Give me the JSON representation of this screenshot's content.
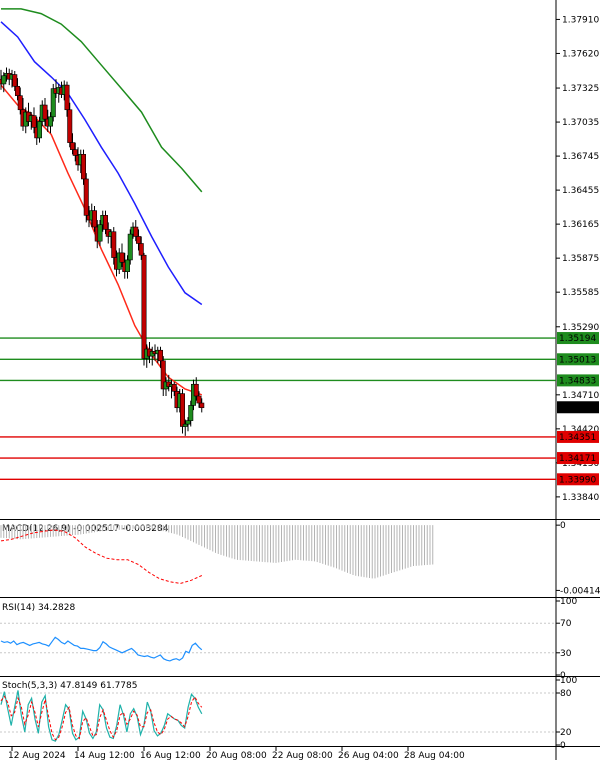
{
  "chart_data": [
    {
      "type": "candlestick",
      "price_scale": {
        "ticks": [
          "1.37910",
          "1.37620",
          "1.37325",
          "1.37035",
          "1.36745",
          "1.36455",
          "1.36165",
          "1.35875",
          "1.35585",
          "1.35290",
          "1.34710",
          "1.34420",
          "1.34130",
          "1.33840"
        ],
        "tick_values": [
          1.3791,
          1.3762,
          1.37325,
          1.37035,
          1.36745,
          1.36455,
          1.36165,
          1.35875,
          1.35585,
          1.3529,
          1.3471,
          1.3442,
          1.3413,
          1.3384
        ],
        "ylim": [
          1.3366,
          1.3805
        ]
      },
      "time_scale": {
        "labels": [
          "12 Aug 2024",
          "14 Aug 12:00",
          "16 Aug 12:00",
          "20 Aug 08:00",
          "22 Aug 08:00",
          "26 Aug 04:00",
          "28 Aug 04:00"
        ],
        "label_bars": [
          4,
          28,
          52,
          76,
          100,
          124,
          148
        ]
      },
      "bar_count": 158,
      "candles": [
        {
          "o": 1.374,
          "h": 1.3748,
          "l": 1.3731,
          "c": 1.3736
        },
        {
          "o": 1.3736,
          "h": 1.3746,
          "l": 1.3729,
          "c": 1.3743
        },
        {
          "o": 1.3743,
          "h": 1.375,
          "l": 1.3738,
          "c": 1.3745
        },
        {
          "o": 1.3745,
          "h": 1.3749,
          "l": 1.3735,
          "c": 1.374
        },
        {
          "o": 1.374,
          "h": 1.3748,
          "l": 1.3733,
          "c": 1.3744
        },
        {
          "o": 1.3744,
          "h": 1.3747,
          "l": 1.373,
          "c": 1.3734
        },
        {
          "o": 1.3734,
          "h": 1.3741,
          "l": 1.3722,
          "c": 1.3726
        },
        {
          "o": 1.3726,
          "h": 1.3733,
          "l": 1.371,
          "c": 1.3714
        },
        {
          "o": 1.3714,
          "h": 1.3724,
          "l": 1.3696,
          "c": 1.37
        },
        {
          "o": 1.37,
          "h": 1.3716,
          "l": 1.3694,
          "c": 1.3712
        },
        {
          "o": 1.3712,
          "h": 1.372,
          "l": 1.37,
          "c": 1.3704
        },
        {
          "o": 1.3704,
          "h": 1.3712,
          "l": 1.3697,
          "c": 1.3709
        },
        {
          "o": 1.3709,
          "h": 1.3716,
          "l": 1.3694,
          "c": 1.3699
        },
        {
          "o": 1.3699,
          "h": 1.3708,
          "l": 1.3684,
          "c": 1.369
        },
        {
          "o": 1.369,
          "h": 1.3708,
          "l": 1.3686,
          "c": 1.3704
        },
        {
          "o": 1.3704,
          "h": 1.3722,
          "l": 1.37,
          "c": 1.3718
        },
        {
          "o": 1.3718,
          "h": 1.3724,
          "l": 1.37,
          "c": 1.3706
        },
        {
          "o": 1.3706,
          "h": 1.3714,
          "l": 1.3695,
          "c": 1.37
        },
        {
          "o": 1.37,
          "h": 1.3712,
          "l": 1.3694,
          "c": 1.3708
        },
        {
          "o": 1.3708,
          "h": 1.3736,
          "l": 1.3704,
          "c": 1.3732
        },
        {
          "o": 1.3732,
          "h": 1.374,
          "l": 1.3724,
          "c": 1.3728
        },
        {
          "o": 1.3728,
          "h": 1.3736,
          "l": 1.372,
          "c": 1.3733
        },
        {
          "o": 1.3733,
          "h": 1.3738,
          "l": 1.3724,
          "c": 1.3727
        },
        {
          "o": 1.3727,
          "h": 1.3739,
          "l": 1.3722,
          "c": 1.3735
        },
        {
          "o": 1.3735,
          "h": 1.3738,
          "l": 1.3708,
          "c": 1.3714
        },
        {
          "o": 1.3714,
          "h": 1.372,
          "l": 1.3682,
          "c": 1.3686
        },
        {
          "o": 1.3686,
          "h": 1.3694,
          "l": 1.3676,
          "c": 1.368
        },
        {
          "o": 1.368,
          "h": 1.3686,
          "l": 1.367,
          "c": 1.3675
        },
        {
          "o": 1.3675,
          "h": 1.3682,
          "l": 1.3662,
          "c": 1.3667
        },
        {
          "o": 1.3667,
          "h": 1.368,
          "l": 1.366,
          "c": 1.3676
        },
        {
          "o": 1.3676,
          "h": 1.368,
          "l": 1.365,
          "c": 1.3655
        },
        {
          "o": 1.3655,
          "h": 1.366,
          "l": 1.3618,
          "c": 1.3624
        },
        {
          "o": 1.3624,
          "h": 1.3632,
          "l": 1.3614,
          "c": 1.362
        },
        {
          "o": 1.362,
          "h": 1.3634,
          "l": 1.3614,
          "c": 1.3628
        },
        {
          "o": 1.3628,
          "h": 1.3632,
          "l": 1.361,
          "c": 1.3614
        },
        {
          "o": 1.3614,
          "h": 1.362,
          "l": 1.3596,
          "c": 1.3602
        },
        {
          "o": 1.3602,
          "h": 1.362,
          "l": 1.3598,
          "c": 1.3616
        },
        {
          "o": 1.3616,
          "h": 1.3628,
          "l": 1.361,
          "c": 1.3624
        },
        {
          "o": 1.3624,
          "h": 1.3628,
          "l": 1.3608,
          "c": 1.3612
        },
        {
          "o": 1.3612,
          "h": 1.3618,
          "l": 1.36,
          "c": 1.3606
        },
        {
          "o": 1.3606,
          "h": 1.3612,
          "l": 1.3596,
          "c": 1.361
        },
        {
          "o": 1.361,
          "h": 1.3614,
          "l": 1.3582,
          "c": 1.3588
        },
        {
          "o": 1.3588,
          "h": 1.3594,
          "l": 1.3572,
          "c": 1.3578
        },
        {
          "o": 1.3578,
          "h": 1.3596,
          "l": 1.3574,
          "c": 1.3592
        },
        {
          "o": 1.3592,
          "h": 1.36,
          "l": 1.358,
          "c": 1.3584
        },
        {
          "o": 1.3584,
          "h": 1.3592,
          "l": 1.357,
          "c": 1.3576
        },
        {
          "o": 1.3576,
          "h": 1.359,
          "l": 1.357,
          "c": 1.3586
        },
        {
          "o": 1.3586,
          "h": 1.3612,
          "l": 1.3582,
          "c": 1.3608
        },
        {
          "o": 1.3608,
          "h": 1.3618,
          "l": 1.3604,
          "c": 1.3614
        },
        {
          "o": 1.3614,
          "h": 1.362,
          "l": 1.3602,
          "c": 1.3606
        },
        {
          "o": 1.3606,
          "h": 1.3612,
          "l": 1.3594,
          "c": 1.36
        },
        {
          "o": 1.36,
          "h": 1.3606,
          "l": 1.3586,
          "c": 1.359
        },
        {
          "o": 1.359,
          "h": 1.3592,
          "l": 1.3496,
          "c": 1.3502
        },
        {
          "o": 1.3502,
          "h": 1.3514,
          "l": 1.3494,
          "c": 1.351
        },
        {
          "o": 1.351,
          "h": 1.3516,
          "l": 1.3498,
          "c": 1.3504
        },
        {
          "o": 1.3504,
          "h": 1.3512,
          "l": 1.3496,
          "c": 1.3508
        },
        {
          "o": 1.3508,
          "h": 1.3514,
          "l": 1.35,
          "c": 1.3506
        },
        {
          "o": 1.3506,
          "h": 1.3512,
          "l": 1.3498,
          "c": 1.3509
        },
        {
          "o": 1.3509,
          "h": 1.3512,
          "l": 1.3494,
          "c": 1.35
        },
        {
          "o": 1.35,
          "h": 1.3504,
          "l": 1.347,
          "c": 1.3476
        },
        {
          "o": 1.3476,
          "h": 1.3486,
          "l": 1.347,
          "c": 1.3482
        },
        {
          "o": 1.3482,
          "h": 1.3488,
          "l": 1.3474,
          "c": 1.3478
        },
        {
          "o": 1.3478,
          "h": 1.3484,
          "l": 1.3468,
          "c": 1.348
        },
        {
          "o": 1.348,
          "h": 1.3482,
          "l": 1.347,
          "c": 1.3474
        },
        {
          "o": 1.3474,
          "h": 1.3478,
          "l": 1.3456,
          "c": 1.346
        },
        {
          "o": 1.346,
          "h": 1.3476,
          "l": 1.3456,
          "c": 1.3472
        },
        {
          "o": 1.3472,
          "h": 1.3476,
          "l": 1.3438,
          "c": 1.3444
        },
        {
          "o": 1.3444,
          "h": 1.345,
          "l": 1.3436,
          "c": 1.3446
        },
        {
          "o": 1.3446,
          "h": 1.3452,
          "l": 1.344,
          "c": 1.3449
        },
        {
          "o": 1.3449,
          "h": 1.3466,
          "l": 1.3444,
          "c": 1.3462
        },
        {
          "o": 1.3462,
          "h": 1.3484,
          "l": 1.3458,
          "c": 1.348
        },
        {
          "o": 1.348,
          "h": 1.3486,
          "l": 1.3466,
          "c": 1.347
        },
        {
          "o": 1.347,
          "h": 1.3474,
          "l": 1.346,
          "c": 1.3464
        },
        {
          "o": 1.3464,
          "h": 1.3468,
          "l": 1.3456,
          "c": 1.346
        }
      ],
      "moving_averages": [
        {
          "color": "#ff2a1a",
          "values": [
            1.3735,
            1.3718,
            1.3708,
            1.3693,
            1.366,
            1.363,
            1.3595,
            1.3565,
            1.353,
            1.3505,
            1.3486,
            1.3476,
            1.3471
          ]
        },
        {
          "color": "#1f1fff",
          "values": [
            1.3789,
            1.3776,
            1.3755,
            1.3742,
            1.3728,
            1.3706,
            1.3682,
            1.366,
            1.3634,
            1.3606,
            1.358,
            1.3558,
            1.3548
          ]
        },
        {
          "color": "#1e8c1e",
          "values": [
            1.38,
            1.38,
            1.3796,
            1.3787,
            1.3772,
            1.3752,
            1.3732,
            1.3712,
            1.3682,
            1.3664,
            1.3644
          ]
        }
      ],
      "levels": [
        {
          "value": 1.35194,
          "label": "1.35194",
          "color": "#1e8c1e"
        },
        {
          "value": 1.35013,
          "label": "1.35013",
          "color": "#1e8c1e"
        },
        {
          "value": 1.34833,
          "label": "1.34833",
          "color": "#1e8c1e"
        },
        {
          "value": 1.34351,
          "label": "1.34351",
          "color": "#e00000"
        },
        {
          "value": 1.34171,
          "label": "1.34171",
          "color": "#e00000"
        },
        {
          "value": 1.3399,
          "label": "1.33990",
          "color": "#e00000"
        }
      ],
      "current_price": {
        "value": 1.34604,
        "label": "1.34604"
      }
    },
    {
      "type": "histogram",
      "title": "MACD(12,26,9) -0.002517 -0.003284",
      "ticks": [
        "0",
        "-0.004145"
      ],
      "tick_values": [
        0,
        -0.004145
      ],
      "ylim": [
        -0.0045,
        0.0002
      ],
      "histogram": [
        -0.0008,
        -0.0009,
        -0.0008,
        -0.0007,
        -0.0006,
        -0.0004,
        -0.0003,
        -0.0002,
        -0.0003,
        -0.0006,
        -0.0012,
        -0.0018,
        -0.0022,
        -0.0023,
        -0.0024,
        -0.0022,
        -0.0023,
        -0.0027,
        -0.0032,
        -0.0034,
        -0.003,
        -0.0026,
        -0.0025
      ],
      "signal": [
        -0.001,
        -0.0009,
        -0.0007,
        -0.0005,
        -0.0004,
        -0.0003,
        -0.0004,
        -0.0008,
        -0.0014,
        -0.0018,
        -0.0021,
        -0.0022,
        -0.0022,
        -0.0025,
        -0.003,
        -0.0034,
        -0.0036,
        -0.0037,
        -0.0035,
        -0.0032
      ],
      "colors": {
        "histogram": "#b4b4b4",
        "signal": "#ff0000"
      }
    },
    {
      "type": "line",
      "title": "RSI(14) 34.2828",
      "ticks": [
        "100",
        "70",
        "30",
        "0"
      ],
      "tick_values": [
        100,
        70,
        30,
        0
      ],
      "ylim": [
        0,
        100
      ],
      "values": [
        46,
        44,
        45,
        43,
        46,
        41,
        43,
        44,
        42,
        40,
        42,
        43,
        44,
        42,
        41,
        39,
        45,
        51,
        48,
        44,
        42,
        46,
        43,
        40,
        39,
        36,
        36,
        35,
        34,
        33,
        33,
        37,
        45,
        42,
        38,
        36,
        34,
        32,
        30,
        32,
        34,
        36,
        32,
        27,
        26,
        25,
        26,
        24,
        23,
        25,
        27,
        22,
        20,
        19,
        21,
        22,
        20,
        23,
        32,
        30,
        40,
        43,
        38,
        34
      ],
      "color": "#1e90ff"
    },
    {
      "type": "line",
      "title": "Stoch(5,3,3) 47.8149 61.7785",
      "ticks": [
        "100",
        "80",
        "20",
        "0"
      ],
      "tick_values": [
        100,
        80,
        20,
        0
      ],
      "ylim": [
        0,
        100
      ],
      "main": [
        62,
        82,
        55,
        30,
        58,
        84,
        45,
        20,
        62,
        72,
        40,
        18,
        66,
        76,
        28,
        8,
        6,
        16,
        38,
        62,
        55,
        18,
        8,
        12,
        52,
        40,
        18,
        10,
        20,
        62,
        54,
        26,
        12,
        10,
        30,
        62,
        46,
        20,
        48,
        56,
        44,
        16,
        30,
        66,
        52,
        22,
        14,
        18,
        30,
        48,
        44,
        40,
        38,
        30,
        26,
        58,
        78,
        72,
        58,
        48
      ],
      "signal": [
        68,
        75,
        65,
        45,
        50,
        72,
        58,
        32,
        46,
        66,
        50,
        28,
        50,
        70,
        44,
        18,
        8,
        12,
        28,
        50,
        58,
        30,
        14,
        10,
        36,
        42,
        28,
        14,
        16,
        42,
        54,
        38,
        22,
        12,
        22,
        46,
        50,
        32,
        40,
        52,
        46,
        28,
        28,
        50,
        54,
        34,
        20,
        16,
        24,
        40,
        44,
        40,
        38,
        34,
        28,
        44,
        66,
        74,
        64,
        58
      ],
      "colors": {
        "main": "#20b2aa",
        "signal": "#ff0000"
      }
    }
  ]
}
